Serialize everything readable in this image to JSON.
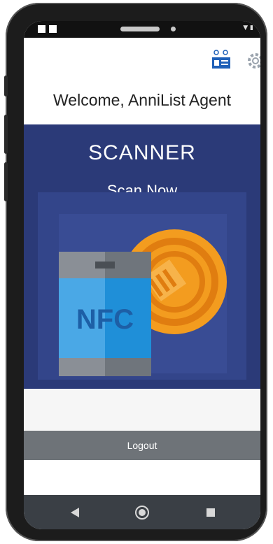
{
  "header": {
    "welcome_text": "Welcome, AnniList Agent",
    "profile_icon": "profile-card-icon",
    "settings_icon": "gear-icon"
  },
  "scanner": {
    "title": "SCANNER",
    "subtitle": "Scan Now",
    "graphic_label": "NFC",
    "colors": {
      "panel": "#2b3a78",
      "coin": "#f39c1f",
      "phone_body": "#4aa8e6"
    }
  },
  "actions": {
    "logout_label": "Logout"
  },
  "system_nav": {
    "back_icon": "back-triangle-icon",
    "home_icon": "home-circle-icon",
    "recents_icon": "recents-square-icon"
  }
}
